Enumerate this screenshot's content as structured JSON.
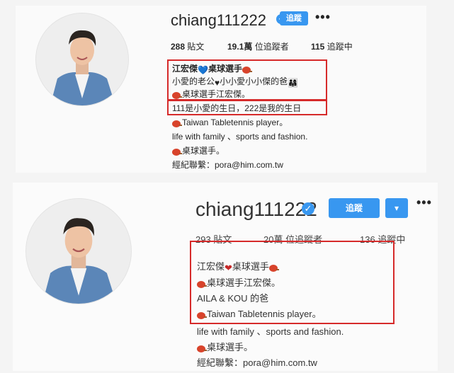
{
  "profiles": [
    {
      "username": "chiang111222",
      "follow_label": "追蹤",
      "more_label": "•••",
      "posts": "288",
      "posts_label": "貼文",
      "followers": "19.1萬",
      "followers_label": "位追蹤者",
      "following": "115",
      "following_label": "追蹤中",
      "bio": [
        {
          "text": "江宏傑",
          "suffix": "桌球選手"
        },
        {
          "text": "小愛的老公",
          "middle": "小小愛小小傑的爸"
        },
        {
          "text": "桌球選手江宏傑。"
        },
        {
          "text": "111是小愛的生日，222是我的生日"
        },
        {
          "text": "Taiwan Tabletennis player。"
        },
        {
          "text": "life with family 、sports and fashion."
        },
        {
          "text": "桌球選手。"
        },
        {
          "text": "經紀聯繫：pora@him.com.tw"
        }
      ]
    },
    {
      "username": "chiang111222",
      "follow_label": "追蹤",
      "dropdown_label": "▾",
      "more_label": "•••",
      "posts": "293",
      "posts_label": "貼文",
      "followers": "20萬",
      "followers_label": "位追蹤者",
      "following": "136",
      "following_label": "追蹤中",
      "bio": [
        {
          "text": "江宏傑",
          "suffix": "桌球選手"
        },
        {
          "text": "桌球選手江宏傑。"
        },
        {
          "text": "AILA & KOU 的爸"
        },
        {
          "text": "Taiwan Tabletennis player。"
        },
        {
          "text": "life with family 、sports and fashion."
        },
        {
          "text": "桌球選手。"
        },
        {
          "text": "經紀聯繫：pora@him.com.tw"
        }
      ]
    }
  ],
  "colors": {
    "accent": "#3897f0",
    "highlight_box": "#d62a2a",
    "heart_blue": "#3d6fd1",
    "heart_red": "#c62828"
  },
  "icons": [
    "verified-badge-icon",
    "heart-icon",
    "pingpong-paddle-icon",
    "family-emoji-icon",
    "more-options-icon",
    "chevron-down-icon"
  ]
}
